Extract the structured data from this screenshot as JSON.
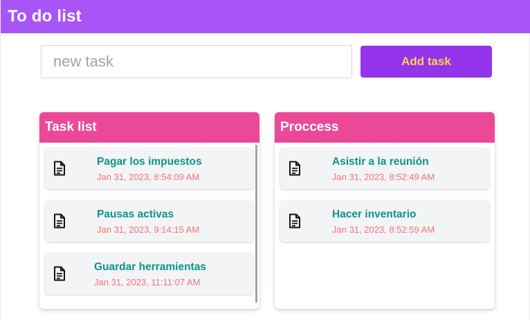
{
  "header": {
    "title": "To do list"
  },
  "new_task": {
    "placeholder": "new task",
    "value": ""
  },
  "add_button": {
    "label": "Add task"
  },
  "task_list": {
    "title": "Task list",
    "items": [
      {
        "name": "Pagar los impuestos",
        "date": "Jan 31, 2023, 8:54:09 AM",
        "icon": "document-icon"
      },
      {
        "name": "Pausas activas",
        "date": "Jan 31, 2023, 9:14:15 AM",
        "icon": "document-icon"
      },
      {
        "name": "Guardar herramientas",
        "date": "Jan 31, 2023, 11:11:07 AM",
        "icon": "document-icon"
      }
    ]
  },
  "process_list": {
    "title": "Proccess",
    "items": [
      {
        "name": "Asistir a la reunión",
        "date": "Jan 31, 2023, 8:52:49 AM",
        "icon": "document-icon"
      },
      {
        "name": "Hacer inventario",
        "date": "Jan 31, 2023, 8:52:59 AM",
        "icon": "document-icon"
      }
    ]
  },
  "colors": {
    "topbar": "#a855f7",
    "button_bg": "#9333ea",
    "button_text": "#fcd34d",
    "panel_header": "#ec4899",
    "task_name": "#0d9488",
    "task_date": "#f87171"
  }
}
